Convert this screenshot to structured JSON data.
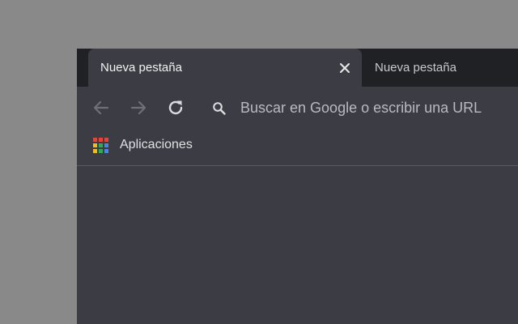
{
  "tabs": [
    {
      "title": "Nueva pestaña",
      "active": true
    },
    {
      "title": "Nueva pestaña",
      "active": false
    }
  ],
  "toolbar": {
    "back_icon": "arrow-back-icon",
    "forward_icon": "arrow-forward-icon",
    "reload_icon": "reload-icon"
  },
  "omnibox": {
    "placeholder": "Buscar en Google o escribir una URL",
    "icon": "search-icon"
  },
  "bookmarks": {
    "apps_label": "Aplicaciones",
    "apps_icon": "apps-grid-icon"
  },
  "colors": {
    "desktop": "#898989",
    "tabstrip": "#202124",
    "frame": "#3c3c44",
    "text_primary": "#f1f1f1",
    "text_secondary": "#b9b9be"
  }
}
